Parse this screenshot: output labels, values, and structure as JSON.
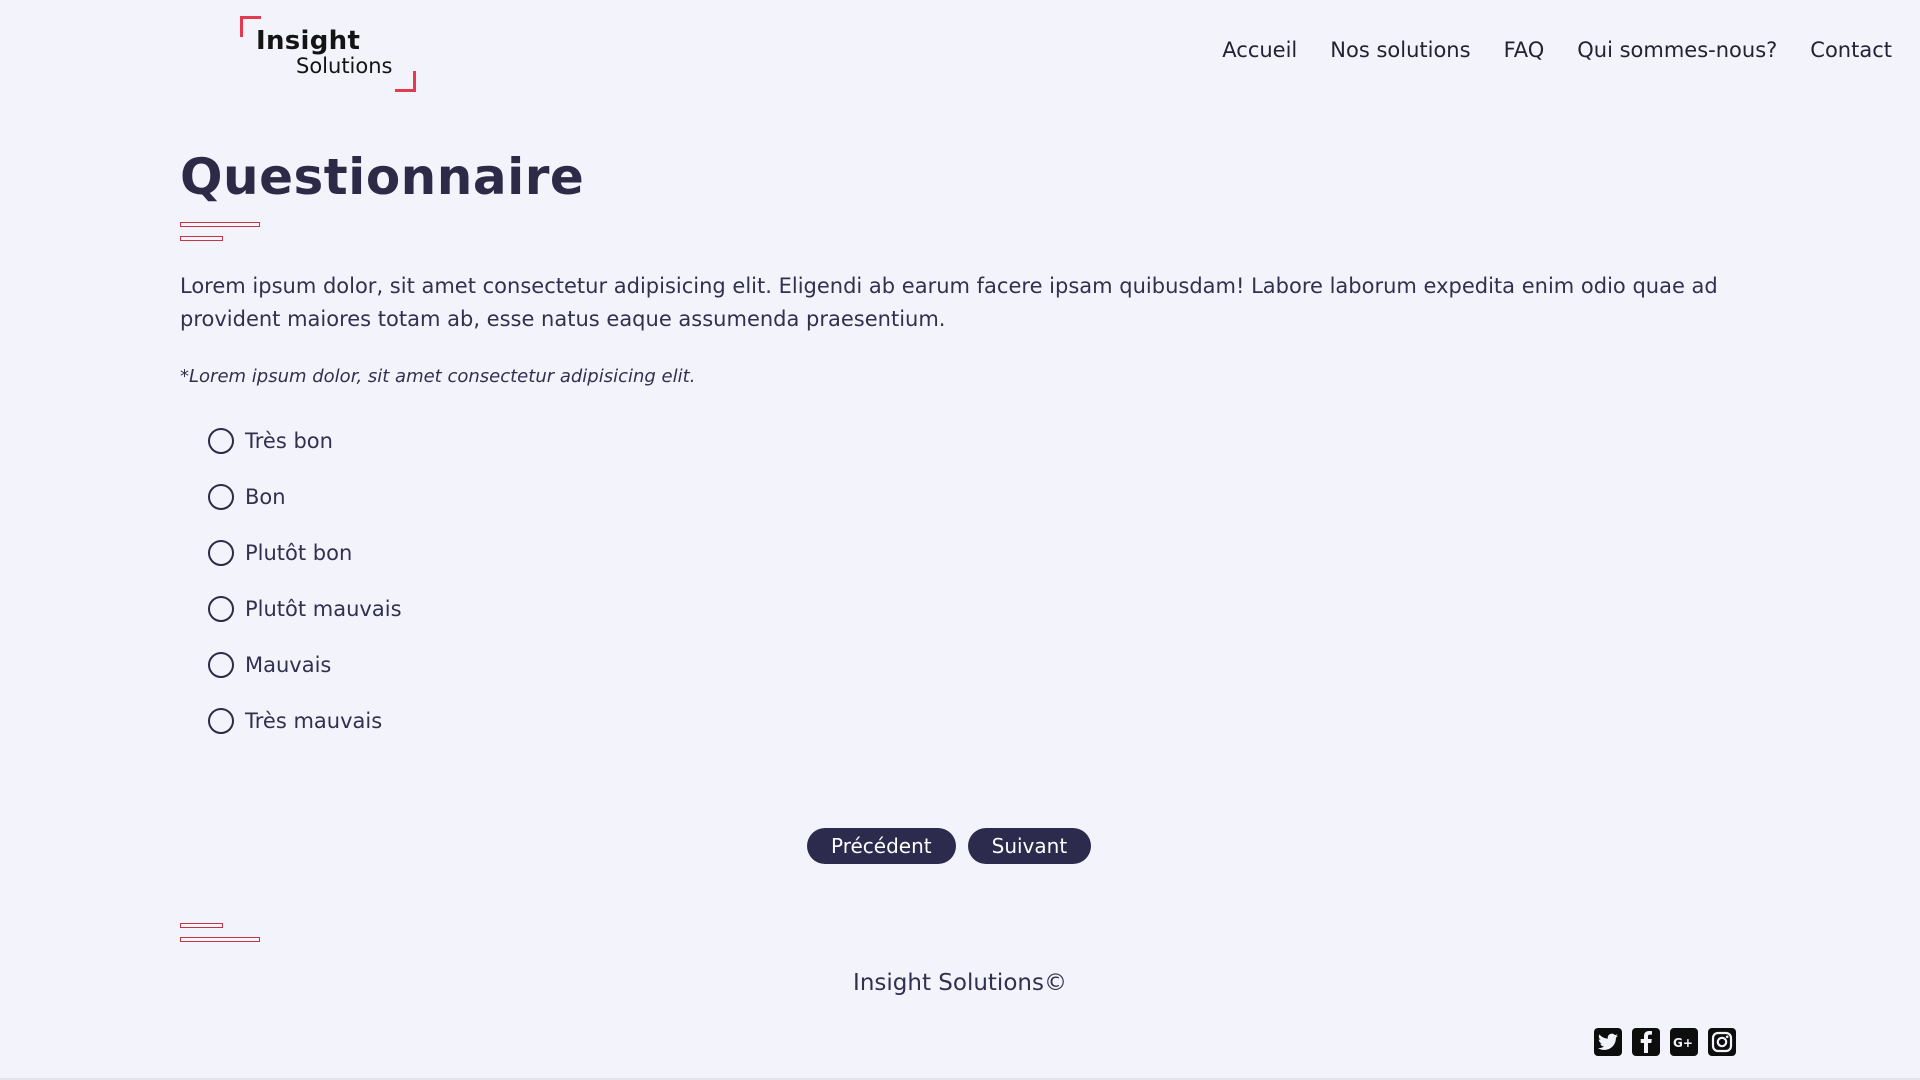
{
  "header": {
    "logo": {
      "line1": "Insight",
      "line2": "Solutions"
    },
    "nav": [
      "Accueil",
      "Nos solutions",
      "FAQ",
      "Qui sommes-nous?",
      "Contact"
    ]
  },
  "main": {
    "title": "Questionnaire",
    "intro": "Lorem ipsum dolor, sit amet consectetur adipisicing elit. Eligendi ab earum facere ipsam quibusdam! Labore laborum expedita enim odio quae ad provident maiores totam ab, esse natus eaque assumenda praesentium.",
    "note": "*Lorem ipsum dolor, sit amet consectetur adipisicing elit.",
    "options": [
      "Très bon",
      "Bon",
      "Plutôt bon",
      "Plutôt mauvais",
      "Mauvais",
      "Très mauvais"
    ],
    "buttons": {
      "previous": "Précédent",
      "next": "Suivant"
    }
  },
  "footer": {
    "copyright": "Insight Solutions©",
    "social": [
      "twitter-icon",
      "facebook-icon",
      "google-plus-icon",
      "instagram-icon"
    ]
  },
  "colors": {
    "background": "#f3f3fb",
    "primary": "#2d2b4d",
    "accent": "#e33a50"
  }
}
